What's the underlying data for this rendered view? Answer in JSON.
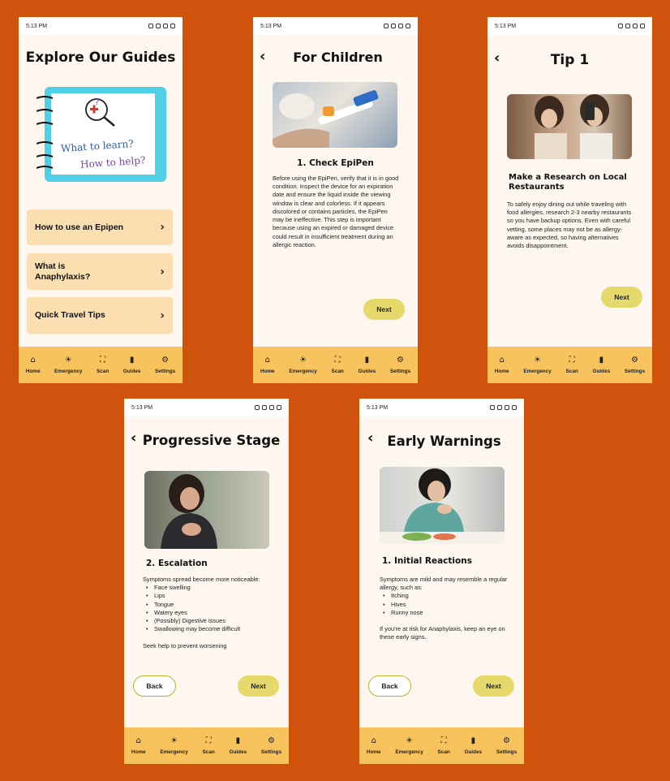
{
  "status_time": "5:13 PM",
  "nav": [
    {
      "label": "Home",
      "icon": "home-icon",
      "glyph": "⌂"
    },
    {
      "label": "Emergency",
      "icon": "alarm-icon",
      "glyph": "☀"
    },
    {
      "label": "Scan",
      "icon": "scan-icon",
      "glyph": "⛶"
    },
    {
      "label": "Guides",
      "icon": "book-icon",
      "glyph": "▮"
    },
    {
      "label": "Settings",
      "icon": "gear-icon",
      "glyph": "⚙"
    }
  ],
  "explore": {
    "title": "Explore Our Guides",
    "notebook_line1": "What to learn?",
    "notebook_line2": "How to help?",
    "buttons": [
      {
        "label": "How to use an Epipen"
      },
      {
        "label": "What is Anaphylaxis?"
      },
      {
        "label": "Quick Travel Tips"
      }
    ]
  },
  "children": {
    "title": "For Children",
    "step_title": "1. Check EpiPen",
    "body": "Before using the EpiPen, verify that it is in good condition. Inspect the device for an expiration date and ensure the liquid inside the viewing window is clear and colorless. If it appears discolored or contains particles, the EpiPen may be ineffective. This step is important because using an expired or damaged device could result in insufficient treatment during an allergic reaction.",
    "next": "Next"
  },
  "tip1": {
    "title": "Tip 1",
    "heading": "Make a Research on Local Restaurants",
    "body": "To safely enjoy dining out while traveling with food allergies, research 2-3 nearby restaurants so you have backup options. Even with careful vetting, some places may not be as allergy-aware as expected, so having alternatives avoids disappointment.",
    "next": "Next"
  },
  "progressive": {
    "title": "Progressive Stage",
    "step_title": "2. Escalation",
    "intro": "Symptoms spread become more noticeable:",
    "bullets": [
      "Face swelling",
      "Lips",
      "Tongue",
      "Watery eyes",
      "(Possibly) Digestive issues",
      "Swallowing may become difficult"
    ],
    "outro": "Seek help to prevent worsening",
    "back": "Back",
    "next": "Next"
  },
  "early": {
    "title": "Early Warnings",
    "step_title": "1. Initial Reactions",
    "intro": "Symptoms are mild and may resemble a regular allergy, such as:",
    "bullets": [
      "Itching",
      "Hives",
      "Runny nose"
    ],
    "outro": "If you're at risk for Anaphylaxis, keep an eye on these early signs.",
    "back": "Back",
    "next": "Next"
  },
  "colors": {
    "background": "#cf520d",
    "screen": "#fdf7ef",
    "navbar": "#f8c35c",
    "guide_button": "#fbdfb1",
    "next_button": "#e5d96c",
    "notebook": "#4fd0e6"
  }
}
